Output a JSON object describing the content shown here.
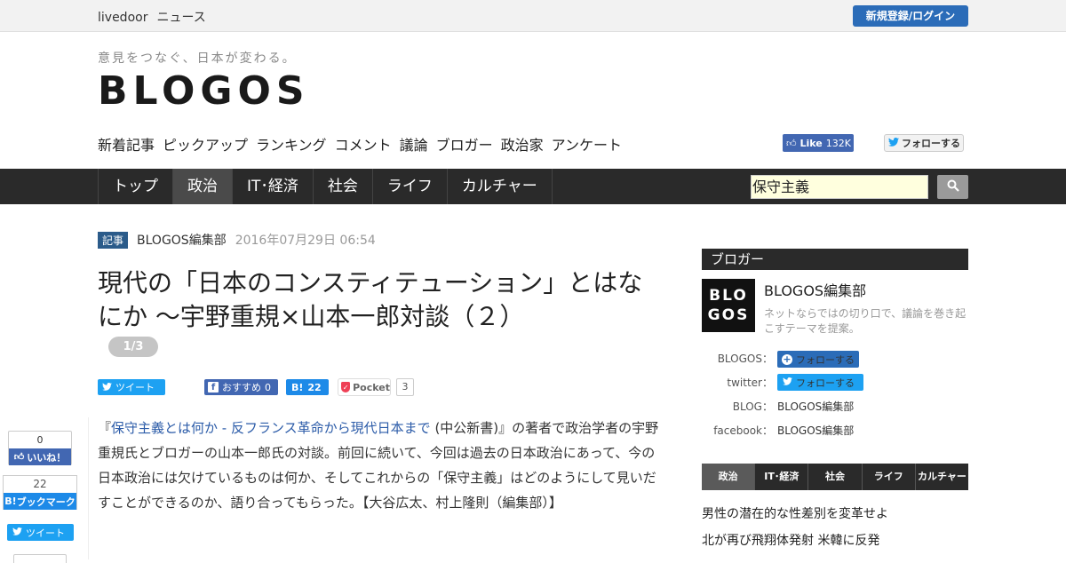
{
  "topbar": {
    "brand": "livedoor",
    "section": "ニュース",
    "login_label": "新規登録/ログイン"
  },
  "header": {
    "tagline": "意見をつなぐ、日本が変わる。",
    "logo": "BLOGOS"
  },
  "subnav": [
    "新着記事",
    "ピックアップ",
    "ランキング",
    "コメント",
    "議論",
    "ブロガー",
    "政治家",
    "アンケート"
  ],
  "social_top": {
    "fb_like_label": "Like",
    "fb_like_count": "132K",
    "tw_follow_label": "フォローする"
  },
  "mainnav": {
    "items": [
      {
        "label": "トップ",
        "active": false
      },
      {
        "label": "政治",
        "active": true
      },
      {
        "label": "IT･経済",
        "active": false
      },
      {
        "label": "社会",
        "active": false
      },
      {
        "label": "ライフ",
        "active": false
      },
      {
        "label": "カルチャー",
        "active": false
      }
    ],
    "search_value": "保守主義"
  },
  "article": {
    "tag": "記事",
    "author": "BLOGOS編集部",
    "date": "2016年07月29日 06:54",
    "title": "現代の「日本のコンスティテューション」とはなにか 〜宇野重規×山本一郎対談（２）",
    "page_badge": "1/3",
    "share": {
      "tweet_label": "ツイート",
      "fb_label": "おすすめ",
      "fb_count": "0",
      "hatena_count": "22",
      "pocket_label": "Pocket",
      "pocket_count": "3"
    },
    "body_open": "『",
    "body_link": "保守主義とは何か - 反フランス革命から現代日本まで",
    "body_rest": " (中公新書)』の著者で政治学者の宇野重規氏とブロガーの山本一郎氏の対談。前回に続いて、今回は過去の日本政治にあって、今の日本政治には欠けているものは何か、そしてこれからの「保守主義」はどのようにして見いだすことができるのか、語り合ってもらった。【大谷広太、村上隆則（編集部）】"
  },
  "float_share": {
    "fb_count": "0",
    "fb_label": "いいね！",
    "hatena_count": "22",
    "hatena_label": "ブックマーク",
    "tweet_label": "ツイート"
  },
  "sidebar": {
    "heading": "ブロガー",
    "logo_line1": "BLO",
    "logo_line2": "GOS",
    "name": "BLOGOS編集部",
    "description": "ネットならではの切り口で、議論を巻き起こすテーマを提案。",
    "rows": {
      "blogos_key": "BLOGOS：",
      "blogos_follow": "フォローする",
      "twitter_key": "twitter：",
      "twitter_follow": "フォローする",
      "blog_key": "BLOG：",
      "blog_value": "BLOGOS編集部",
      "facebook_key": "facebook：",
      "facebook_value": "BLOGOS編集部"
    },
    "cat_tabs": [
      {
        "label": "政治",
        "active": true
      },
      {
        "label": "IT･経済",
        "active": false
      },
      {
        "label": "社会",
        "active": false
      },
      {
        "label": "ライフ",
        "active": false
      },
      {
        "label": "カルチャー",
        "active": false
      }
    ],
    "headlines": [
      "男性の潜在的な性差別を変革せよ",
      "北が再び飛翔体発射 米韓に反発"
    ]
  },
  "colors": {
    "nav_bg": "#2a2a2a",
    "brand_blue": "#2b6cb8",
    "twitter": "#1da1f2",
    "facebook": "#4267b2",
    "hatena": "#1d8ae8",
    "pocket": "#ef4056"
  }
}
